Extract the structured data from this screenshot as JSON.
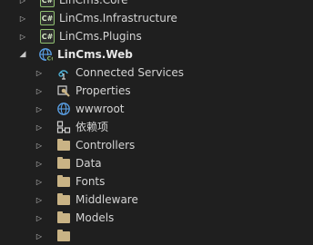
{
  "solution_explorer": {
    "projects": [
      {
        "label": "LinCms.Core",
        "icon": "csharp-project-icon"
      },
      {
        "label": "LinCms.Infrastructure",
        "icon": "csharp-project-icon"
      },
      {
        "label": "LinCms.Plugins",
        "icon": "csharp-project-icon"
      }
    ],
    "web_project": {
      "label": "LinCms.Web",
      "icon": "web-project-globe-icon",
      "children": [
        {
          "label": "Connected Services",
          "icon": "connected-services-icon"
        },
        {
          "label": "Properties",
          "icon": "properties-wrench-icon"
        },
        {
          "label": "wwwroot",
          "icon": "globe-icon"
        },
        {
          "label": "依赖项",
          "icon": "dependencies-icon"
        },
        {
          "label": "Controllers",
          "icon": "folder-icon"
        },
        {
          "label": "Data",
          "icon": "folder-icon"
        },
        {
          "label": "Fonts",
          "icon": "folder-icon"
        },
        {
          "label": "Middleware",
          "icon": "folder-icon"
        },
        {
          "label": "Models",
          "icon": "folder-icon"
        },
        {
          "label": "",
          "icon": "folder-icon"
        }
      ]
    },
    "icon_text": {
      "csharp": "C#"
    },
    "colors": {
      "background": "#1f1f1f",
      "folder": "#c9b385",
      "text": "#d4d4d4"
    }
  }
}
